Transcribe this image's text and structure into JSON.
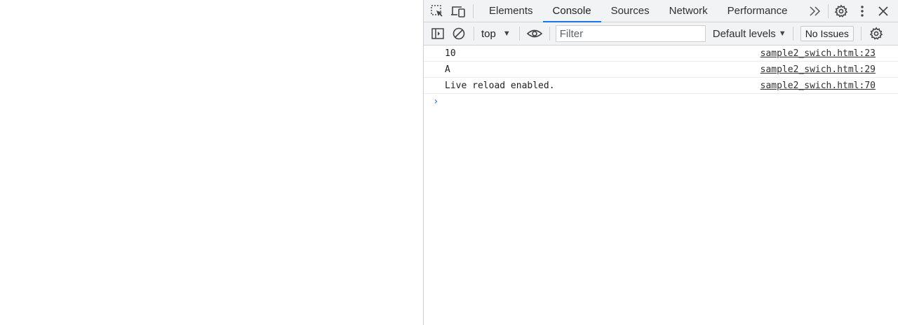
{
  "devtools": {
    "tabs": [
      {
        "label": "Elements",
        "active": false
      },
      {
        "label": "Console",
        "active": true
      },
      {
        "label": "Sources",
        "active": false
      },
      {
        "label": "Network",
        "active": false
      },
      {
        "label": "Performance",
        "active": false
      }
    ],
    "icons": {
      "inspect": "inspect-element-icon",
      "device": "device-toolbar-icon",
      "more_tabs": "more-tabs-icon",
      "settings": "gear-icon",
      "menu": "vertical-dots-icon",
      "close": "close-icon"
    },
    "accent_color": "#1a73e8"
  },
  "toolbar": {
    "context": "top",
    "filter_placeholder": "Filter",
    "levels_label": "Default levels",
    "issues_label": "No Issues"
  },
  "console": {
    "messages": [
      {
        "text": "10",
        "source": "sample2_swich.html:23"
      },
      {
        "text": "A",
        "source": "sample2_swich.html:29"
      },
      {
        "text": "Live reload enabled.",
        "source": "sample2_swich.html:70"
      }
    ],
    "prompt_symbol": "›"
  }
}
